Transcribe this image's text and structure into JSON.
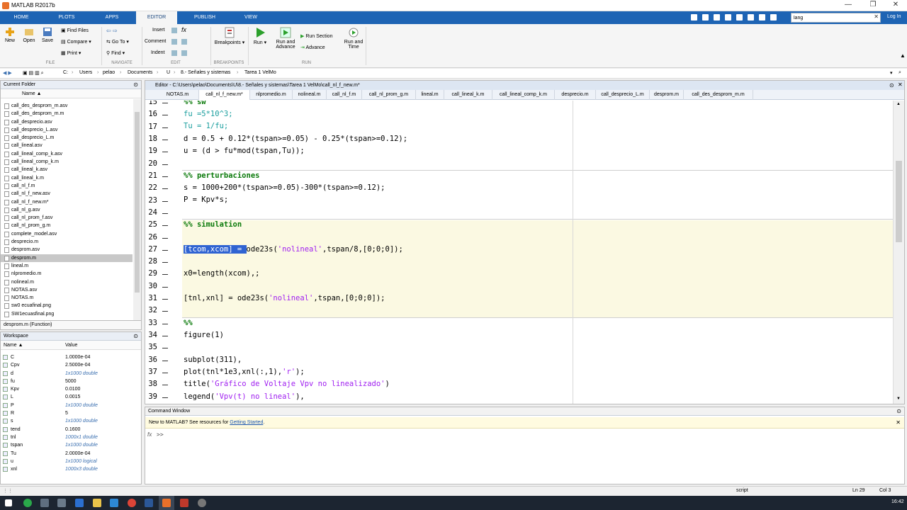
{
  "window": {
    "title": "MATLAB R2017b"
  },
  "ribbon_tabs": [
    {
      "label": "HOME"
    },
    {
      "label": "PLOTS"
    },
    {
      "label": "APPS"
    },
    {
      "label": "EDITOR"
    },
    {
      "label": "PUBLISH"
    },
    {
      "label": "VIEW"
    }
  ],
  "search": {
    "value": "lang"
  },
  "login": "Log In",
  "ribbon": {
    "new": "New",
    "open": "Open",
    "save": "Save",
    "find_files": "Find Files",
    "compare": "Compare",
    "print": "Print",
    "go_to": "Go To",
    "find": "Find",
    "insert": "Insert",
    "comment": "Comment",
    "indent": "Indent",
    "fx": "fx",
    "breakpoints": "Breakpoints",
    "run": "Run",
    "run_and_advance": "Run and Advance",
    "run_section": "Run Section",
    "advance": "Advance",
    "run_and_time": "Run and Time",
    "groups": {
      "file": "FILE",
      "navigate": "NAVIGATE",
      "edit": "EDIT",
      "breakpoints": "BREAKPOINTS",
      "run": "RUN"
    }
  },
  "address": {
    "parts": [
      "C:",
      "Users",
      "pelao",
      "Documents",
      "U",
      "8.- Señales y sistemas",
      "Tarea 1 VelMo"
    ]
  },
  "current_folder": {
    "title": "Current Folder",
    "col": "Name ▲",
    "files": [
      "call_des_desprom_m.asv",
      "call_des_desprom_m.m",
      "call_desprecio.asv",
      "call_desprecio_L.asv",
      "call_desprecio_L.m",
      "call_lineal.asv",
      "call_lineal_comp_k.asv",
      "call_lineal_comp_k.m",
      "call_lineal_k.asv",
      "call_lineal_k.m",
      "call_nl_f.m",
      "call_nl_f_new.asv",
      "call_nl_f_new.m*",
      "call_nl_g.asv",
      "call_nl_prom_f.asv",
      "call_nl_prom_g.m",
      "complete_model.asv",
      "desprecio.m",
      "desprom.asv",
      "desprom.m",
      "lineal.m",
      "nlpromedio.m",
      "nolineal.m",
      "NOTAS.asv",
      "NOTAS.m",
      "sw0 ecuafinal.png",
      "SW1ecuasfinal.png"
    ],
    "selected": "desprom.m",
    "detail": "desprom.m  (Function)"
  },
  "workspace": {
    "title": "Workspace",
    "col_name": "Name ▲",
    "col_value": "Value",
    "vars": [
      {
        "name": "C",
        "value": "1.0000e-04",
        "italic": false
      },
      {
        "name": "Cpv",
        "value": "2.5000e-04",
        "italic": false
      },
      {
        "name": "d",
        "value": "1x1000 double",
        "italic": true
      },
      {
        "name": "fu",
        "value": "5000",
        "italic": false
      },
      {
        "name": "Kpv",
        "value": "0.0100",
        "italic": false
      },
      {
        "name": "L",
        "value": "0.0015",
        "italic": false
      },
      {
        "name": "P",
        "value": "1x1000 double",
        "italic": true
      },
      {
        "name": "R",
        "value": "5",
        "italic": false
      },
      {
        "name": "s",
        "value": "1x1000 double",
        "italic": true
      },
      {
        "name": "tend",
        "value": "0.1600",
        "italic": false
      },
      {
        "name": "tnl",
        "value": "1000x1 double",
        "italic": true
      },
      {
        "name": "tspan",
        "value": "1x1000 double",
        "italic": true
      },
      {
        "name": "Tu",
        "value": "2.0000e-04",
        "italic": false
      },
      {
        "name": "u",
        "value": "1x1000 logical",
        "italic": true
      },
      {
        "name": "xnl",
        "value": "1000x3 double",
        "italic": true
      }
    ]
  },
  "editor": {
    "header": "Editor - C:\\Users\\pelao\\Documents\\U\\8.- Señales y sistemas\\Tarea 1 VelMo\\call_nl_f_new.m*",
    "tabs": [
      "NOTAS.m",
      "call_nl_f_new.m*",
      "nlpromedio.m",
      "nolineal.m",
      "call_nl_f.m",
      "call_nl_prom_g.m",
      "lineal.m",
      "call_lineal_k.m",
      "call_lineal_comp_k.m",
      "desprecio.m",
      "call_desprecio_L.m",
      "desprom.m",
      "call_des_desprom_m.m"
    ],
    "active_tab": "call_nl_f_new.m*",
    "line_numbers": [
      "15",
      "16",
      "17",
      "18",
      "19",
      "20",
      "21",
      "22",
      "23",
      "24",
      "25",
      "26",
      "27",
      "28",
      "29",
      "30",
      "31",
      "32",
      "33",
      "34",
      "35",
      "36",
      "37",
      "38",
      "39"
    ],
    "code": {
      "l15": "%% sw",
      "l16a": "fu =5*10^3;",
      "l17a": "Tu = 1/fu;",
      "l18a": "d = 0.5 + 0.12*(tspan>=0.05) - 0.25*(tspan>=0.12);",
      "l19a": "u = (d > fu*mod(tspan,Tu));",
      "l21": "%% perturbaciones",
      "l22": "s = 1000+200*(tspan>=0.05)-300*(tspan>=0.12);",
      "l23a": "P = Kpv*s;",
      "l25": "%% simulation",
      "l27sel": "[tcom,xcom] = ",
      "l27a": "ode23s(",
      "l27s": "'nolineal'",
      "l27b": ",tspan/8,[0;0;0]);",
      "l29": "x0=length(xcom),;",
      "l31a": "[tnl,xnl] = ode23s(",
      "l31s": "'nolineal'",
      "l31b": ",tspan,[0;0;0]);",
      "l33": "%%",
      "l34": "figure(1)",
      "l36": "subplot(311),",
      "l37a": "plot(tnl*1e3,xnl(:,1),",
      "l37s": "'r'",
      "l37b": ");",
      "l38a": "title(",
      "l38s": "'Gráfico de Voltaje Vpv no linealizado'",
      "l38b": ")",
      "l39a": "legend(",
      "l39s": "'Vpv(t) no lineal'",
      "l39b": "),"
    }
  },
  "command_window": {
    "title": "Command Window",
    "notice": "New to MATLAB? See resources for ",
    "link": "Getting Started",
    "notice_end": ".",
    "prompt": ">>",
    "fx": "fx"
  },
  "status": {
    "mode": "script",
    "ln": "Ln 29",
    "col": "Col 3"
  },
  "taskbar": {
    "time": "16:42"
  },
  "colors": {
    "ribbon_tab_bg": "#1e64b4",
    "cell_bg": "#fbf9e2",
    "selection": "#2f63d2",
    "comment": "#228b22",
    "string": "#a020f0"
  }
}
